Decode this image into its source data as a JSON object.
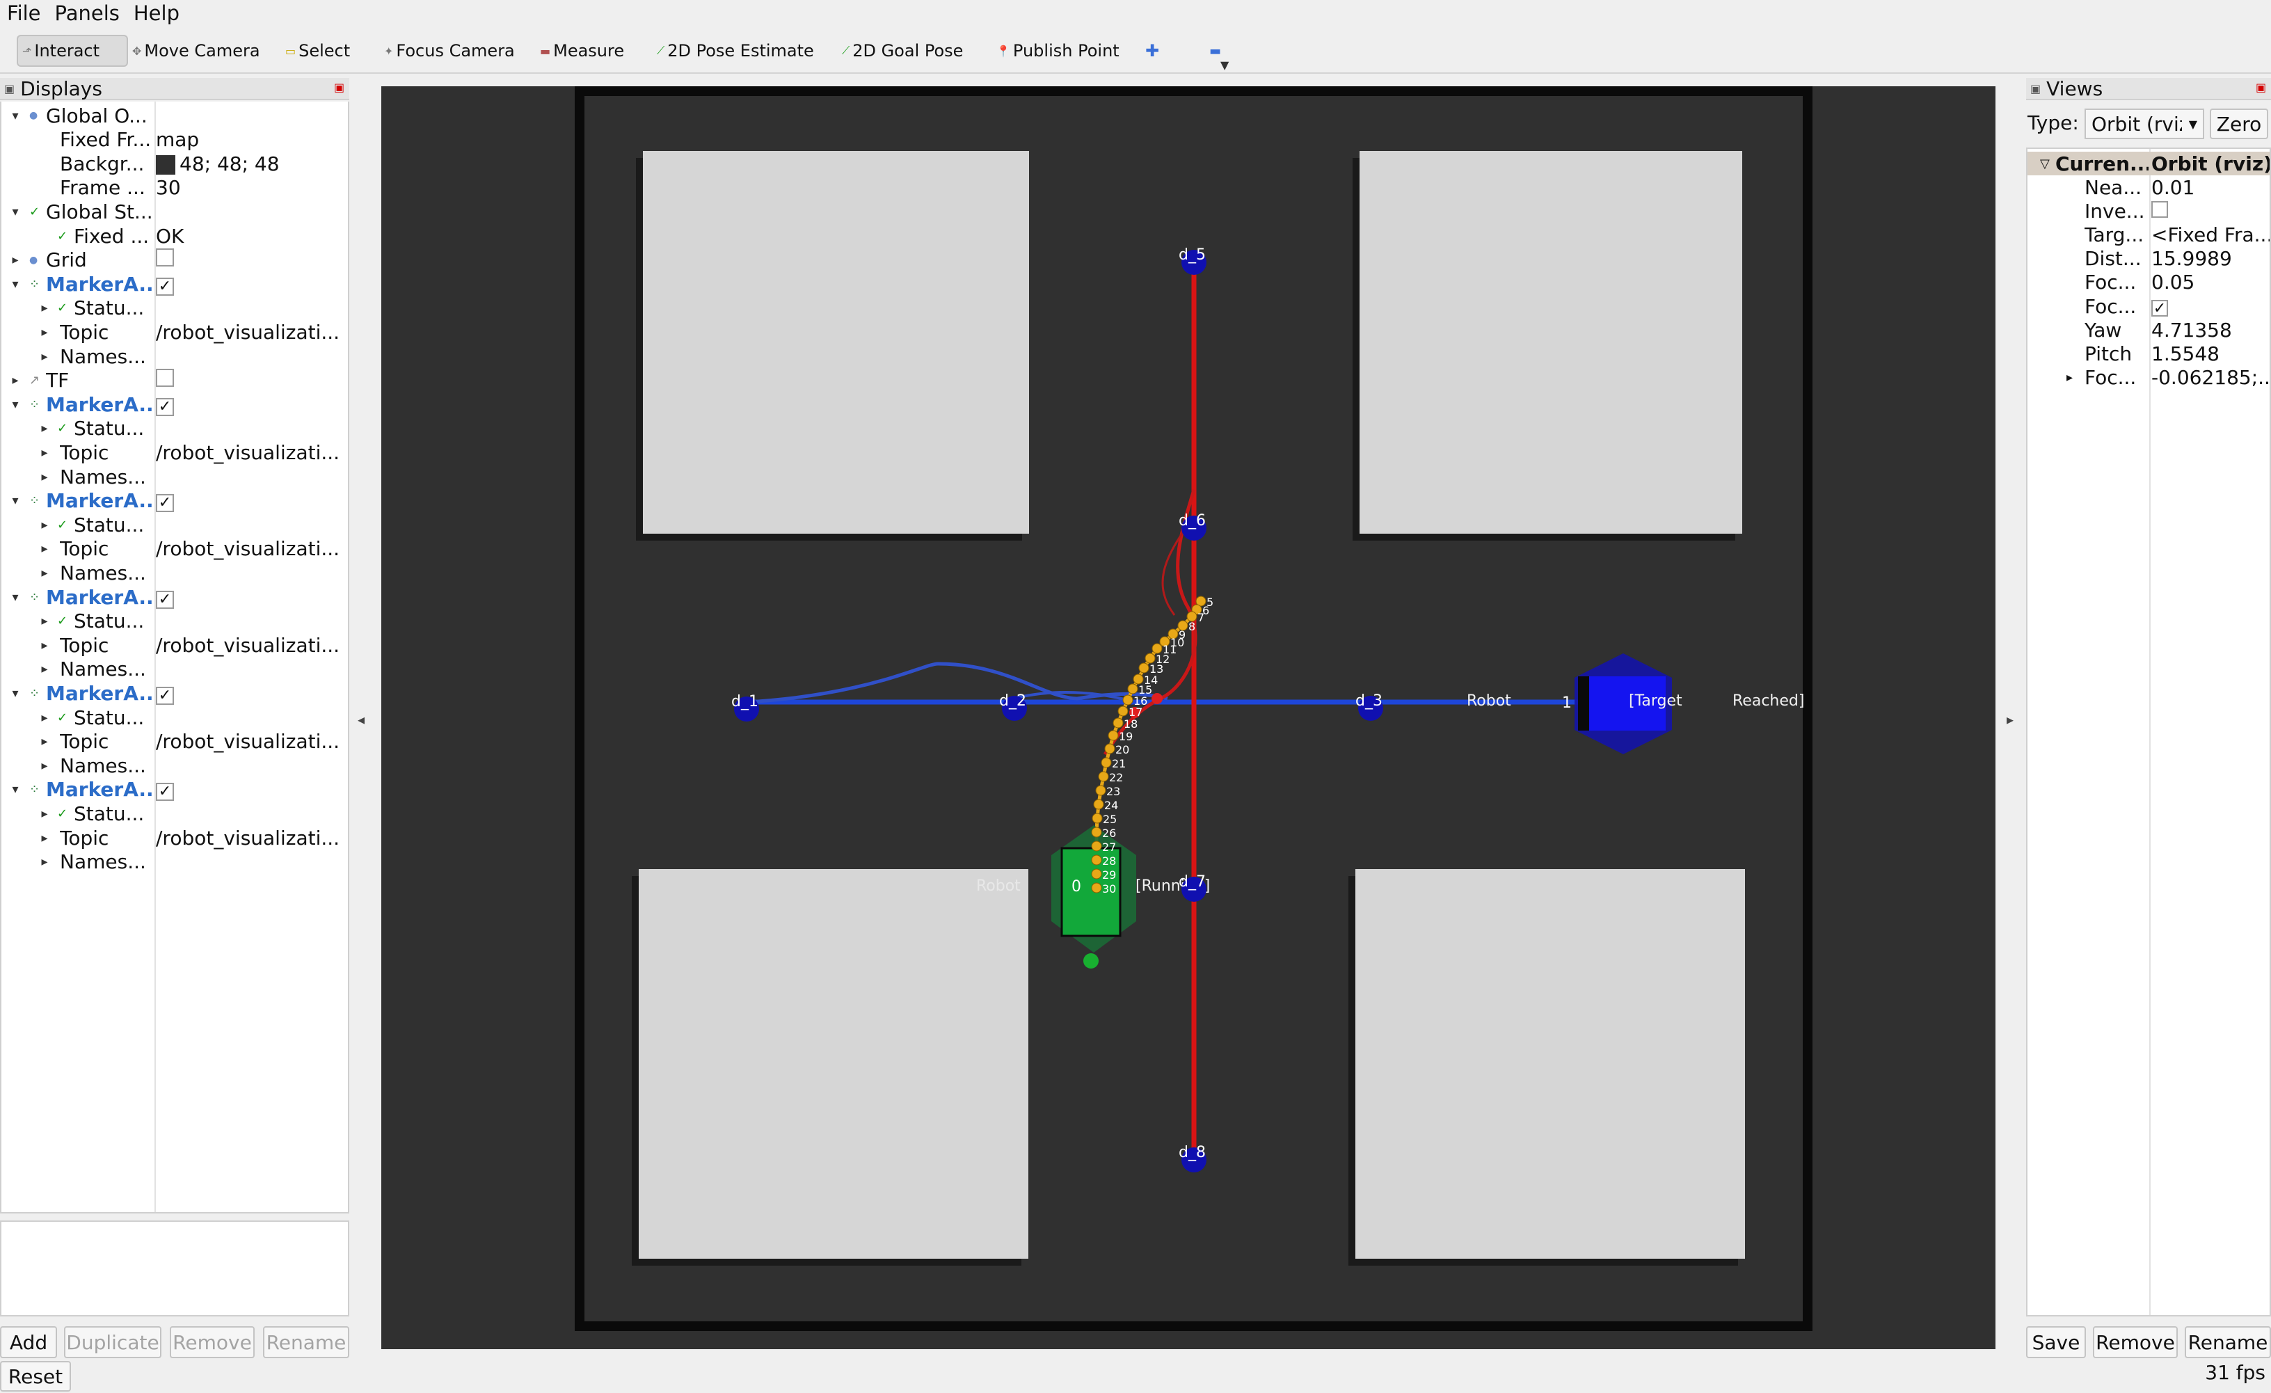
{
  "menu": [
    "File",
    "Panels",
    "Help"
  ],
  "toolbar": {
    "interact": "Interact",
    "move_camera": "Move Camera",
    "select": "Select",
    "focus_camera": "Focus Camera",
    "measure": "Measure",
    "pose_estimate": "2D Pose Estimate",
    "goal_pose": "2D Goal Pose",
    "publish_point": "Publish Point"
  },
  "displays": {
    "title": "Displays",
    "rows": [
      {
        "label": "Global O...",
        "value": ""
      },
      {
        "label": "Fixed Fr...",
        "value": "map"
      },
      {
        "label": "Backgr...",
        "value": "48; 48; 48"
      },
      {
        "label": "Frame ...",
        "value": "30"
      },
      {
        "label": "Global St...",
        "value": ""
      },
      {
        "label": "Fixed ...",
        "value": "OK"
      },
      {
        "label": "Grid",
        "value": ""
      },
      {
        "label": "MarkerA...",
        "value": "✓"
      },
      {
        "label": "Statu...",
        "value": ""
      },
      {
        "label": "Topic",
        "value": "/robot_visualizati..."
      },
      {
        "label": "Names...",
        "value": ""
      },
      {
        "label": "TF",
        "value": ""
      },
      {
        "label": "MarkerA...",
        "value": "✓"
      },
      {
        "label": "Statu...",
        "value": ""
      },
      {
        "label": "Topic",
        "value": "/robot_visualizati..."
      },
      {
        "label": "Names...",
        "value": ""
      },
      {
        "label": "MarkerA...",
        "value": "✓"
      },
      {
        "label": "Statu...",
        "value": ""
      },
      {
        "label": "Topic",
        "value": "/robot_visualizati..."
      },
      {
        "label": "Names...",
        "value": ""
      },
      {
        "label": "MarkerA...",
        "value": "✓"
      },
      {
        "label": "Statu...",
        "value": ""
      },
      {
        "label": "Topic",
        "value": "/robot_visualizati..."
      },
      {
        "label": "Names...",
        "value": ""
      },
      {
        "label": "MarkerA...",
        "value": "✓"
      },
      {
        "label": "Statu...",
        "value": ""
      },
      {
        "label": "Topic",
        "value": "/robot_visualizati..."
      },
      {
        "label": "Names...",
        "value": ""
      },
      {
        "label": "MarkerA...",
        "value": "✓"
      },
      {
        "label": "Statu...",
        "value": ""
      },
      {
        "label": "Topic",
        "value": "/robot_visualizati..."
      },
      {
        "label": "Names...",
        "value": ""
      }
    ],
    "buttons": {
      "add": "Add",
      "duplicate": "Duplicate",
      "remove": "Remove",
      "rename": "Rename"
    },
    "reset": "Reset"
  },
  "views": {
    "title": "Views",
    "type_label": "Type:",
    "type_value": "Orbit (rviz)",
    "zero": "Zero",
    "header": {
      "label": "Curren...",
      "value": "Orbit (rviz)"
    },
    "rows": [
      {
        "label": "Nea...",
        "value": "0.01"
      },
      {
        "label": "Inve...",
        "value": ""
      },
      {
        "label": "Targ...",
        "value": "<Fixed Fra..."
      },
      {
        "label": "Dist...",
        "value": "15.9989"
      },
      {
        "label": "Foc...",
        "value": "0.05"
      },
      {
        "label": "Foc...",
        "value": "✓"
      },
      {
        "label": "Yaw",
        "value": "4.71358"
      },
      {
        "label": "Pitch",
        "value": "1.5548"
      },
      {
        "label": "Foc...",
        "value": "-0.062185;..."
      }
    ],
    "buttons": {
      "save": "Save",
      "remove": "Remove",
      "rename": "Rename"
    }
  },
  "scene": {
    "nodes": [
      "d_1",
      "d_2",
      "d_3",
      "d_5",
      "d_6",
      "d_7",
      "d_8"
    ],
    "robot0": {
      "name": "Robot",
      "id": "0",
      "status": "[Running]"
    },
    "robot1": {
      "name": "Robot",
      "id": "1",
      "status": "Reached]",
      "target": "[Target"
    },
    "path_labels": [
      "5",
      "6",
      "7",
      "8",
      "9",
      "10",
      "11",
      "12",
      "13",
      "14",
      "15",
      "16",
      "17",
      "18",
      "19",
      "20",
      "21",
      "22",
      "23",
      "24",
      "25",
      "26",
      "27",
      "28",
      "29",
      "30"
    ],
    "colors": {
      "background": "#303030",
      "block": "#d6d6d6",
      "blue_path": "#1e46d8",
      "red_path": "#d81414",
      "node": "#1010b0",
      "robot0": "#12a83a",
      "robot1": "#1414f0",
      "waypoint": "#e8a818"
    }
  },
  "fps": "31 fps"
}
